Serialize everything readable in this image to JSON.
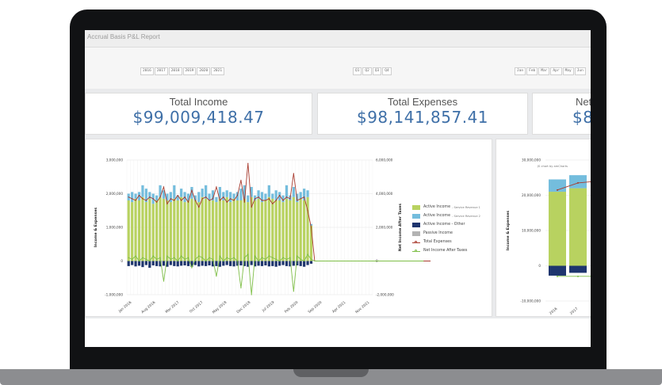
{
  "report": {
    "title": "Accrual Basis P&L Report"
  },
  "filters": {
    "years": [
      "2016",
      "2017",
      "2018",
      "2019",
      "2020",
      "2021"
    ],
    "quarters": [
      "Q1",
      "Q2",
      "Q3",
      "Q4"
    ],
    "months": [
      "Jan",
      "Feb",
      "Mar",
      "Apr",
      "May",
      "Jun"
    ]
  },
  "kpis": [
    {
      "label": "Total Income",
      "value": "$99,009,418.47"
    },
    {
      "label": "Total Expenses",
      "value": "$98,141,857.41"
    },
    {
      "label": "Net",
      "value": "$8"
    }
  ],
  "colors": {
    "accent": "#3e6fa7",
    "service1": "#b8d260",
    "service2": "#74bddd",
    "other": "#1e356e",
    "passive": "#b3b3b3",
    "expenses": "#a83a2d",
    "net": "#7fbf48"
  },
  "chart_data": [
    {
      "type": "bar",
      "ylabel": "Income & Expenses",
      "y2label": "Net Income After Taxes",
      "y_ticks": [
        "3,000,000",
        "2,000,000",
        "1,000,000",
        "0",
        "-1,000,000"
      ],
      "y2_ticks": [
        "6,000,000",
        "4,000,000",
        "2,000,000",
        "0",
        "-2,000,000"
      ],
      "ylim": [
        -1000000,
        3000000
      ],
      "y2lim": [
        -2000000,
        6000000
      ],
      "x_ticks": [
        "Jan 2016",
        "Aug 2016",
        "Mar 2017",
        "Oct 2017",
        "May 2018",
        "Dec 2018",
        "Jul 2019",
        "Feb 2020",
        "Sep 2020",
        "Apr 2021",
        "Nov 2021"
      ],
      "legend": [
        "Active Income - Service Revenue 1",
        "Active Income - Service Revenue 2",
        "Active Income - Other",
        "Passive Income",
        "Total Expenses",
        "Net Income After Taxes"
      ],
      "legend_short": [
        "Active Income",
        "Active Income",
        "Active Income - Other",
        "Passive Income",
        "Total Expenses",
        "Net Income After Taxes"
      ],
      "legend_sub": [
        "- Service Revenue 1",
        "- Service Revenue 2",
        "",
        "",
        "",
        ""
      ],
      "series": [
        {
          "name": "Active Income - Service Revenue 1",
          "values": [
            1800000,
            1750000,
            1850000,
            1800000,
            1900000,
            1750000,
            1850000,
            1700000,
            1800000,
            1900000,
            1850000,
            1800000,
            1750000,
            1850000,
            1800000,
            1900000,
            1750000,
            1800000,
            1850000,
            1800000,
            1750000,
            1900000,
            1850000,
            1800000,
            1800000,
            1750000,
            1850000,
            1800000,
            1900000,
            1750000,
            1850000,
            1800000,
            1800000,
            1850000,
            1750000,
            1900000,
            1800000,
            1850000,
            1750000,
            1800000,
            1900000,
            1850000,
            1800000,
            1800000,
            1750000,
            1850000,
            1800000,
            1900000,
            1750000,
            1850000,
            1800000,
            1900000,
            1050000
          ]
        },
        {
          "name": "Active Income - Service Revenue 2",
          "values": [
            200000,
            300000,
            150000,
            250000,
            350000,
            400000,
            200000,
            300000,
            150000,
            350000,
            250000,
            200000,
            300000,
            400000,
            150000,
            250000,
            300000,
            200000,
            350000,
            150000,
            300000,
            250000,
            400000,
            200000,
            300000,
            150000,
            350000,
            250000,
            200000,
            300000,
            150000,
            250000,
            350000,
            400000,
            200000,
            300000,
            150000,
            250000,
            300000,
            200000,
            350000,
            150000,
            300000,
            250000,
            200000,
            400000,
            150000,
            300000,
            250000,
            200000,
            350000,
            200000,
            50000
          ]
        },
        {
          "name": "Active Income - Other",
          "values": [
            -150000,
            -120000,
            -160000,
            -140000,
            -180000,
            -120000,
            -200000,
            -130000,
            -150000,
            -160000,
            -140000,
            -170000,
            -120000,
            -150000,
            -160000,
            -140000,
            -130000,
            -150000,
            -170000,
            -120000,
            -160000,
            -140000,
            -150000,
            -130000,
            -160000,
            -150000,
            -170000,
            -140000,
            -120000,
            -150000,
            -160000,
            -140000,
            -130000,
            -150000,
            -170000,
            -120000,
            -160000,
            -140000,
            -150000,
            -130000,
            -160000,
            -150000,
            -170000,
            -140000,
            -120000,
            -150000,
            -160000,
            -140000,
            -130000,
            -150000,
            -170000,
            -120000,
            -80000
          ]
        },
        {
          "name": "Total Expenses",
          "values": [
            1900000,
            1850000,
            1800000,
            1950000,
            1850000,
            1800000,
            1900000,
            1850000,
            1750000,
            1900000,
            2200000,
            1700000,
            1850000,
            1800000,
            1950000,
            1800000,
            1900000,
            1750000,
            2100000,
            1800000,
            1600000,
            1850000,
            1900000,
            1800000,
            1850000,
            2200000,
            1800000,
            1900000,
            1750000,
            1850000,
            1800000,
            1950000,
            2400000,
            1750000,
            2900000,
            1600000,
            1850000,
            1900000,
            1800000,
            1800000,
            1850000,
            1700000,
            1800000,
            1950000,
            1800000,
            1900000,
            1850000,
            2600000,
            1800000,
            1850000,
            1900000,
            1500000,
            1000000,
            0,
            0,
            0,
            0,
            0,
            0,
            0,
            0,
            0,
            0,
            0,
            0,
            0,
            0,
            0,
            0,
            0,
            0,
            0,
            0,
            0,
            0,
            0,
            0,
            0,
            0,
            0,
            0,
            0,
            0,
            0,
            0,
            0,
            0
          ]
        },
        {
          "name": "Net Income After Taxes",
          "values": [
            200000,
            100000,
            300000,
            0,
            200000,
            100000,
            0,
            300000,
            100000,
            200000,
            -1200000,
            300000,
            100000,
            200000,
            0,
            300000,
            100000,
            200000,
            -400000,
            100000,
            300000,
            200000,
            0,
            200000,
            100000,
            -900000,
            300000,
            0,
            200000,
            100000,
            200000,
            0,
            -1600000,
            200000,
            400000,
            -2000000,
            300000,
            0,
            200000,
            100000,
            300000,
            200000,
            100000,
            0,
            200000,
            100000,
            200000,
            -1800000,
            300000,
            100000,
            0,
            400000,
            100000,
            0,
            0,
            0,
            0,
            0,
            0,
            0,
            0,
            0,
            0,
            0,
            0,
            0,
            0,
            0,
            0,
            0,
            0,
            0,
            0,
            0,
            0,
            0,
            0,
            0,
            0,
            0,
            0,
            0,
            0,
            0,
            0
          ]
        }
      ]
    },
    {
      "type": "bar",
      "note": "JS chart by amCharts",
      "ylabel": "Income & Expenses",
      "y_ticks": [
        "30,000,000",
        "20,000,000",
        "10,000,000",
        "0",
        "-10,000,000"
      ],
      "ylim": [
        -10000000,
        30000000
      ],
      "categories": [
        "2016",
        "2017"
      ],
      "series": [
        {
          "name": "Active Income - Service Revenue 1",
          "values": [
            21000000,
            22000000
          ]
        },
        {
          "name": "Active Income - Service Revenue 2",
          "values": [
            3500000,
            3700000
          ]
        },
        {
          "name": "Active Income - Other",
          "values": [
            -2800000,
            -2000000
          ]
        },
        {
          "name": "Total Expenses",
          "values": [
            21500000,
            23500000
          ]
        },
        {
          "name": "Net Income After Taxes",
          "values": [
            -3000000,
            -3000000
          ]
        }
      ]
    }
  ]
}
